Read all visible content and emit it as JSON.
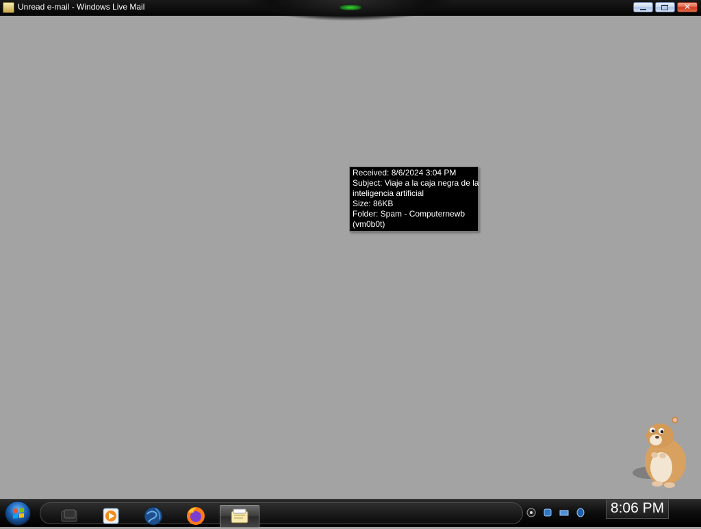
{
  "window": {
    "title": "Unread e-mail - Windows Live Mail",
    "buttons": {
      "minimize": "minimize-icon",
      "maximize": "restore-icon",
      "close": "close-icon",
      "close_glyph": "✕"
    }
  },
  "tooltip": {
    "lines": [
      "Received: 8/6/2024 3:04 PM",
      "Subject: Viaje a la caja negra de la",
      "inteligencia artificial",
      "Size: 86KB",
      "Folder:  Spam - Computernewb",
      "(vm0b0t)"
    ]
  },
  "taskbar": {
    "start": "windows-start-icon",
    "quick_launch": [
      {
        "icon": "show-desktop-icon"
      },
      {
        "icon": "windows-media-player-icon"
      },
      {
        "icon": "internet-globe-icon"
      },
      {
        "icon": "firefox-icon"
      },
      {
        "icon": "windows-live-mail-icon",
        "active": true
      }
    ],
    "tray_icons": [
      "media-control-icon",
      "network-icon",
      "volume-icon",
      "security-icon"
    ],
    "clock": "8:06 PM"
  },
  "gadget": {
    "icon": "hamster-gadget"
  },
  "colors": {
    "desktop": "#a3a3a3",
    "titlebar": "#050505",
    "tooltip_bg": "#000000",
    "tooltip_text": "#ffffff",
    "taskbar": "#0e0e0e"
  }
}
